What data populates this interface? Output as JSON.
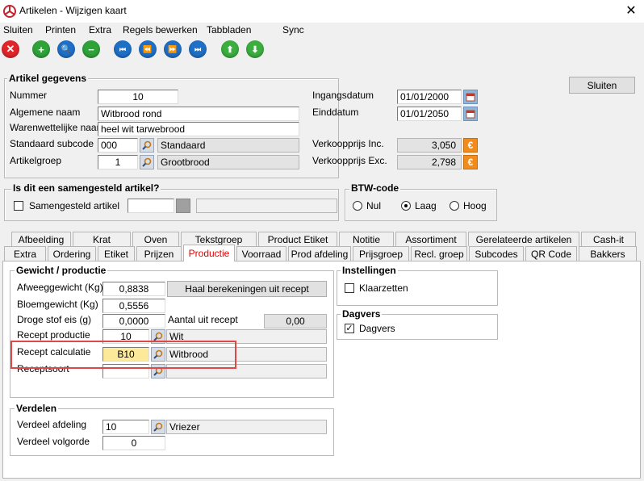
{
  "window": {
    "title": "Artikelen - Wijzigen kaart",
    "close": "✕"
  },
  "menu": [
    "Sluiten",
    "Printen",
    "Extra",
    "Regels bewerken",
    "Tabbladen",
    "Sync"
  ],
  "toolbar": {
    "close": "✕",
    "add": "+",
    "search": "🔍",
    "remove": "−",
    "first": "⏮",
    "prev": "⏪",
    "next": "⏩",
    "last": "⏭",
    "up": "⬆",
    "down": "⬇"
  },
  "artikel": {
    "title": "Artikel gegevens",
    "nummer_label": "Nummer",
    "nummer": "10",
    "alg_naam_label": "Algemene naam",
    "alg_naam": "Witbrood rond",
    "waren_label": "Warenwettelijke naam",
    "waren": "heel wit tarwebrood",
    "subcode_label": "Standaard subcode",
    "subcode": "000",
    "subcode_desc": "Standaard",
    "groep_label": "Artikelgroep",
    "groep": "1",
    "groep_desc": "Grootbrood",
    "ingang_label": "Ingangsdatum",
    "ingang": "01/01/2000",
    "eind_label": "Einddatum",
    "eind": "01/01/2050",
    "vk_inc_label": "Verkoopprijs Inc.",
    "vk_inc": "3,050",
    "vk_exc_label": "Verkoopprijs Exc.",
    "vk_exc": "2,798",
    "euro": "€"
  },
  "sluiten_button": "Sluiten",
  "samengesteld": {
    "title": "Is dit een samengesteld artikel?",
    "check_label": "Samengesteld artikel"
  },
  "btw": {
    "title": "BTW-code",
    "options": [
      "Nul",
      "Laag",
      "Hoog"
    ],
    "selected": "Laag"
  },
  "tabs_row1": [
    "Afbeelding",
    "Krat",
    "Oven",
    "Tekstgroep",
    "Product Etiket",
    "Notitie",
    "Assortiment",
    "Gerelateerde artikelen",
    "Cash-it"
  ],
  "tabs_row2": [
    "Extra",
    "Ordering",
    "Etiket",
    "Prijzen",
    "Productie",
    "Voorraad",
    "Prod afdeling",
    "Prijsgroep",
    "Recl. groep",
    "Subcodes",
    "QR Code",
    "Bakkers"
  ],
  "active_tab": "Productie",
  "gewicht": {
    "title": "Gewicht / productie",
    "afweeg_label": "Afweeggewicht (Kg)",
    "afweeg": "0,8838",
    "bloem_label": "Bloemgewicht (Kg)",
    "bloem": "0,5556",
    "droge_label": "Droge stof eis (g)",
    "droge": "0,0000",
    "haal_button": "Haal berekeningen uit recept",
    "aantal_label": "Aantal uit recept",
    "aantal": "0,00",
    "recept_prod_label": "Recept productie",
    "recept_prod": "10",
    "recept_prod_desc": "Wit",
    "recept_calc_label": "Recept calculatie",
    "recept_calc": "B10",
    "recept_calc_desc": "Witbrood",
    "receptsoort_label": "Receptsoort"
  },
  "instellingen": {
    "title": "Instellingen",
    "klaarzetten": "Klaarzetten"
  },
  "dagvers": {
    "title": "Dagvers",
    "dagvers_label": "Dagvers",
    "check": "✓"
  },
  "verdelen": {
    "title": "Verdelen",
    "afdeling_label": "Verdeel afdeling",
    "afdeling": "10",
    "afdeling_desc": "Vriezer",
    "volgorde_label": "Verdeel volgorde",
    "volgorde": "0"
  },
  "colors": {
    "accent_red": "#e00000",
    "highlight": "#e04848",
    "euro": "#f08b1c"
  }
}
